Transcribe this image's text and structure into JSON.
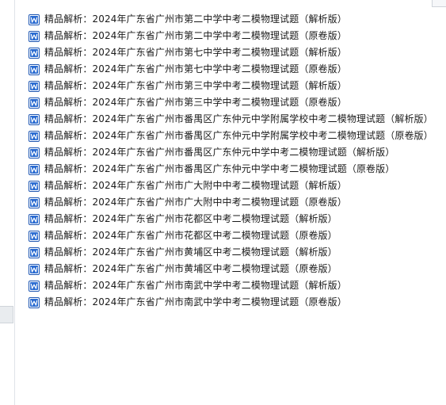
{
  "files": [
    {
      "name": "精品解析：2024年广东省广州市第二中学中考二模物理试题（解析版）",
      "icon": "word-doc-icon"
    },
    {
      "name": "精品解析：2024年广东省广州市第二中学中考二模物理试题（原卷版）",
      "icon": "word-doc-icon"
    },
    {
      "name": "精品解析：2024年广东省广州市第七中学中考二模物理试题（解析版）",
      "icon": "word-doc-icon"
    },
    {
      "name": "精品解析：2024年广东省广州市第七中学中考二模物理试题（原卷版）",
      "icon": "word-doc-icon"
    },
    {
      "name": "精品解析：2024年广东省广州市第三中学中考二模物理试题（解析版）",
      "icon": "word-doc-icon"
    },
    {
      "name": "精品解析：2024年广东省广州市第三中学中考二模物理试题（原卷版）",
      "icon": "word-doc-icon"
    },
    {
      "name": "精品解析：2024年广东省广州市番禺区广东仲元中学附属学校中考二模物理试题（解析版）",
      "icon": "word-doc-icon"
    },
    {
      "name": "精品解析：2024年广东省广州市番禺区广东仲元中学附属学校中考二模物理试题（原卷版）",
      "icon": "word-doc-icon"
    },
    {
      "name": "精品解析：2024年广东省广州市番禺区广东仲元中学中考二模物理试题（解析版）",
      "icon": "word-doc-icon"
    },
    {
      "name": "精品解析：2024年广东省广州市番禺区广东仲元中学中考二模物理试题（原卷版）",
      "icon": "word-doc-icon"
    },
    {
      "name": "精品解析：2024年广东省广州市广大附中中考二模物理试题（解析版）",
      "icon": "word-doc-icon"
    },
    {
      "name": "精品解析：2024年广东省广州市广大附中中考二模物理试题（原卷版）",
      "icon": "word-doc-icon"
    },
    {
      "name": "精品解析：2024年广东省广州市花都区中考二模物理试题（解析版）",
      "icon": "word-doc-icon"
    },
    {
      "name": "精品解析：2024年广东省广州市花都区中考二模物理试题（原卷版）",
      "icon": "word-doc-icon"
    },
    {
      "name": "精品解析：2024年广东省广州市黄埔区中考二模物理试题（解析版）",
      "icon": "word-doc-icon"
    },
    {
      "name": "精品解析：2024年广东省广州市黄埔区中考二模物理试题（原卷版）",
      "icon": "word-doc-icon"
    },
    {
      "name": "精品解析：2024年广东省广州市南武中学中考二模物理试题（解析版）",
      "icon": "word-doc-icon"
    },
    {
      "name": "精品解析：2024年广东省广州市南武中学中考二模物理试题（原卷版）",
      "icon": "word-doc-icon"
    }
  ],
  "colors": {
    "icon_blue": "#2b6cd1",
    "icon_border": "#1f57b2"
  }
}
